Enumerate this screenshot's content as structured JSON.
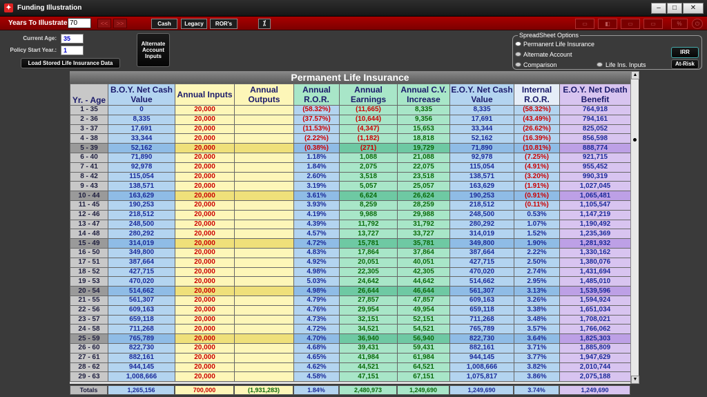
{
  "window": {
    "title": "Funding Illustration",
    "app_icon": "app-logo-icon",
    "min": "–",
    "max": "□",
    "close": "✕"
  },
  "toolbar": {
    "years_label": "Years To Illustrate:",
    "years_value": "70",
    "prev_label": "<<",
    "next_label": ">>",
    "cash_label": "Cash",
    "legacy_label": "Legacy",
    "rors_label": "ROR's",
    "calc_icon_glyph": "⁒",
    "dim_buttons": [
      "▭",
      "◧",
      "▭",
      "▭"
    ],
    "percent_label": "%",
    "power_glyph": "⏻"
  },
  "inputs": {
    "current_age_label": "Current Age:",
    "current_age_value": "35",
    "policy_start_label": "Policy Start Year.:",
    "policy_start_value": "1",
    "load_button": "Load Stored Life Insurance Data",
    "alt_account_button": "Alternate Account Inputs"
  },
  "spreadsheet_options": {
    "title": "SpreadSheet Options",
    "options": [
      "Permanent Life Insurance",
      "Alternate Account",
      "Comparison",
      "Life Ins. Inputs"
    ],
    "irr_button": "IRR",
    "atrisk_button": "At-Risk"
  },
  "grid": {
    "title": "Permanent Life Insurance",
    "columns": [
      "Yr. - Age",
      "B.O.Y. Net Cash Value",
      "Annual Inputs",
      "Annual Outputs",
      "Annual R.O.R.",
      "Annual Earnings",
      "Annual C.V. Increase",
      "E.O.Y. Net Cash Value",
      "Internal R.O.R.",
      "E.O.Y. Net Death Benefit"
    ],
    "rows": [
      [
        "1 - 35",
        "0",
        "20,000",
        "",
        "(58.32%)",
        "(11,665)",
        "8,335",
        "8,335",
        "(58.32%)",
        "764,918"
      ],
      [
        "2 - 36",
        "8,335",
        "20,000",
        "",
        "(37.57%)",
        "(10,644)",
        "9,356",
        "17,691",
        "(43.49%)",
        "794,161"
      ],
      [
        "3 - 37",
        "17,691",
        "20,000",
        "",
        "(11.53%)",
        "(4,347)",
        "15,653",
        "33,344",
        "(26.62%)",
        "825,052"
      ],
      [
        "4 - 38",
        "33,344",
        "20,000",
        "",
        "(2.22%)",
        "(1,182)",
        "18,818",
        "52,162",
        "(16.39%)",
        "856,598"
      ],
      [
        "5 - 39",
        "52,162",
        "20,000",
        "",
        "(0.38%)",
        "(271)",
        "19,729",
        "71,890",
        "(10.81%)",
        "888,774"
      ],
      [
        "6 - 40",
        "71,890",
        "20,000",
        "",
        "1.18%",
        "1,088",
        "21,088",
        "92,978",
        "(7.25%)",
        "921,715"
      ],
      [
        "7 - 41",
        "92,978",
        "20,000",
        "",
        "1.84%",
        "2,075",
        "22,075",
        "115,054",
        "(4.91%)",
        "955,452"
      ],
      [
        "8 - 42",
        "115,054",
        "20,000",
        "",
        "2.60%",
        "3,518",
        "23,518",
        "138,571",
        "(3.20%)",
        "990,319"
      ],
      [
        "9 - 43",
        "138,571",
        "20,000",
        "",
        "3.19%",
        "5,057",
        "25,057",
        "163,629",
        "(1.91%)",
        "1,027,045"
      ],
      [
        "10 - 44",
        "163,629",
        "20,000",
        "",
        "3.61%",
        "6,624",
        "26,624",
        "190,253",
        "(0.91%)",
        "1,065,481"
      ],
      [
        "11 - 45",
        "190,253",
        "20,000",
        "",
        "3.93%",
        "8,259",
        "28,259",
        "218,512",
        "(0.11%)",
        "1,105,547"
      ],
      [
        "12 - 46",
        "218,512",
        "20,000",
        "",
        "4.19%",
        "9,988",
        "29,988",
        "248,500",
        "0.53%",
        "1,147,219"
      ],
      [
        "13 - 47",
        "248,500",
        "20,000",
        "",
        "4.39%",
        "11,792",
        "31,792",
        "280,292",
        "1.07%",
        "1,190,492"
      ],
      [
        "14 - 48",
        "280,292",
        "20,000",
        "",
        "4.57%",
        "13,727",
        "33,727",
        "314,019",
        "1.52%",
        "1,235,369"
      ],
      [
        "15 - 49",
        "314,019",
        "20,000",
        "",
        "4.72%",
        "15,781",
        "35,781",
        "349,800",
        "1.90%",
        "1,281,932"
      ],
      [
        "16 - 50",
        "349,800",
        "20,000",
        "",
        "4.83%",
        "17,864",
        "37,864",
        "387,664",
        "2.22%",
        "1,330,162"
      ],
      [
        "17 - 51",
        "387,664",
        "20,000",
        "",
        "4.92%",
        "20,051",
        "40,051",
        "427,715",
        "2.50%",
        "1,380,076"
      ],
      [
        "18 - 52",
        "427,715",
        "20,000",
        "",
        "4.98%",
        "22,305",
        "42,305",
        "470,020",
        "2.74%",
        "1,431,694"
      ],
      [
        "19 - 53",
        "470,020",
        "20,000",
        "",
        "5.03%",
        "24,642",
        "44,642",
        "514,662",
        "2.95%",
        "1,485,010"
      ],
      [
        "20 - 54",
        "514,662",
        "20,000",
        "",
        "4.98%",
        "26,644",
        "46,644",
        "561,307",
        "3.13%",
        "1,539,596"
      ],
      [
        "21 - 55",
        "561,307",
        "20,000",
        "",
        "4.79%",
        "27,857",
        "47,857",
        "609,163",
        "3.26%",
        "1,594,924"
      ],
      [
        "22 - 56",
        "609,163",
        "20,000",
        "",
        "4.76%",
        "29,954",
        "49,954",
        "659,118",
        "3.38%",
        "1,651,034"
      ],
      [
        "23 - 57",
        "659,118",
        "20,000",
        "",
        "4.73%",
        "32,151",
        "52,151",
        "711,268",
        "3.48%",
        "1,708,021"
      ],
      [
        "24 - 58",
        "711,268",
        "20,000",
        "",
        "4.72%",
        "34,521",
        "54,521",
        "765,789",
        "3.57%",
        "1,766,062"
      ],
      [
        "25 - 59",
        "765,789",
        "20,000",
        "",
        "4.70%",
        "36,940",
        "56,940",
        "822,730",
        "3.64%",
        "1,825,303"
      ],
      [
        "26 - 60",
        "822,730",
        "20,000",
        "",
        "4.68%",
        "39,431",
        "59,431",
        "882,161",
        "3.71%",
        "1,885,809"
      ],
      [
        "27 - 61",
        "882,161",
        "20,000",
        "",
        "4.65%",
        "41,984",
        "61,984",
        "944,145",
        "3.77%",
        "1,947,629"
      ],
      [
        "28 - 62",
        "944,145",
        "20,000",
        "",
        "4.62%",
        "44,521",
        "64,521",
        "1,008,666",
        "3.82%",
        "2,010,744"
      ],
      [
        "29 - 63",
        "1,008,666",
        "20,000",
        "",
        "4.58%",
        "47,151",
        "67,151",
        "1,075,817",
        "3.86%",
        "2,075,188"
      ]
    ],
    "highlight_rows": [
      4,
      9,
      14,
      19,
      24
    ],
    "totals": [
      "Totals",
      "1,265,156",
      "700,000",
      "(1,931,283)",
      "1.84%",
      "2,480,973",
      "1,249,690",
      "1,249,690",
      "3.74%",
      "1,249,690"
    ]
  },
  "colors": {
    "blue": "#b3d4f0",
    "blue_hl": "#8fbce6",
    "yellow": "#fdf6b8",
    "yellow_hl": "#efe07a",
    "green": "#a8e6c8",
    "green_hl": "#6ec9a3",
    "purple": "#d8c4f0",
    "purple_hl": "#bda0e6",
    "red_text": "#cc0000",
    "blue_text": "#1a2a99",
    "green_text": "#0a6a0a",
    "title_red": "#a90000"
  }
}
